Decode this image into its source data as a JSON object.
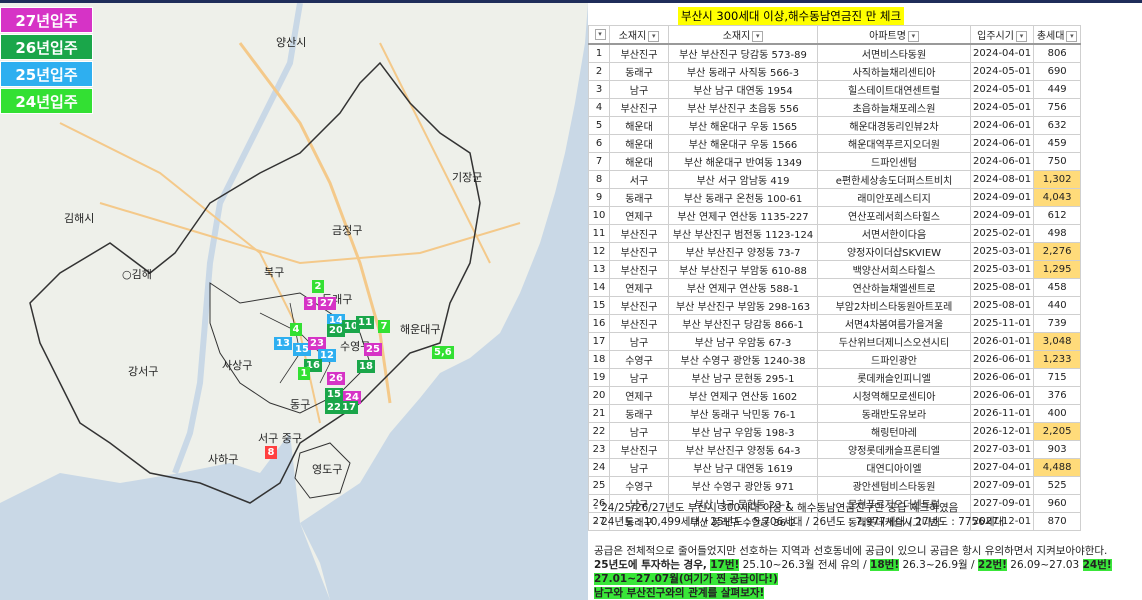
{
  "legend": [
    {
      "label": "27년입주",
      "color": "#d633c6"
    },
    {
      "label": "26년입주",
      "color": "#1aa64a"
    },
    {
      "label": "25년입주",
      "color": "#2eaff0"
    },
    {
      "label": "24년입주",
      "color": "#33e033"
    }
  ],
  "map_places": {
    "yangsan": "양산시",
    "gijang": "기장군",
    "gimhae": "김해시",
    "geumjeong": "금정구",
    "bukgu": "북구",
    "gangseo": "강서구",
    "sasang": "사상구",
    "haeundae": "해운대구",
    "donggu": "동구",
    "saha": "사하구",
    "yeongdo": "영도구",
    "junggu": "서구 중구",
    "gimhae2": "○김해",
    "dongrae": "동래구",
    "suyeong": "수영구"
  },
  "markers": [
    {
      "t": "2",
      "c": "#33e033"
    },
    {
      "t": "3",
      "c": "#d633c6"
    },
    {
      "t": "27",
      "c": "#d633c6"
    },
    {
      "t": "14",
      "c": "#2eaff0"
    },
    {
      "t": "20",
      "c": "#1aa64a"
    },
    {
      "t": "10",
      "c": "#1aa64a"
    },
    {
      "t": "11",
      "c": "#1aa64a"
    },
    {
      "t": "7",
      "c": "#33e033"
    },
    {
      "t": "4",
      "c": "#33e033"
    },
    {
      "t": "13",
      "c": "#2eaff0"
    },
    {
      "t": "15",
      "c": "#2eaff0"
    },
    {
      "t": "23",
      "c": "#d633c6"
    },
    {
      "t": "12",
      "c": "#2eaff0"
    },
    {
      "t": "16",
      "c": "#1aa64a"
    },
    {
      "t": "25",
      "c": "#d633c6"
    },
    {
      "t": "1",
      "c": "#33e033"
    },
    {
      "t": "18",
      "c": "#1aa64a"
    },
    {
      "t": "5,6",
      "c": "#33e033"
    },
    {
      "t": "26",
      "c": "#d633c6"
    },
    {
      "t": "15",
      "c": "#1aa64a"
    },
    {
      "t": "24",
      "c": "#d633c6"
    },
    {
      "t": "22",
      "c": "#1aa64a"
    },
    {
      "t": "17",
      "c": "#1aa64a"
    },
    {
      "t": "8",
      "c": "#ff4040"
    }
  ],
  "table": {
    "title": "부산시 300세대 이상,해수동남연금진 만 체크",
    "headers": [
      "",
      "소재지",
      "소재지",
      "아파트명",
      "입주시기",
      "총세대"
    ],
    "rows": [
      [
        "1",
        "부산진구",
        "부산 부산진구 당감동 573-89",
        "서면비스타동원",
        "2024-04-01",
        "806",
        ""
      ],
      [
        "2",
        "동래구",
        "부산 동래구 사직동 566-3",
        "사직하늘채리센티아",
        "2024-05-01",
        "690",
        ""
      ],
      [
        "3",
        "남구",
        "부산 남구 대연동 1954",
        "힐스테이트대연센트럴",
        "2024-05-01",
        "449",
        ""
      ],
      [
        "4",
        "부산진구",
        "부산 부산진구 초읍동 556",
        "초읍하늘채포레스원",
        "2024-05-01",
        "756",
        ""
      ],
      [
        "5",
        "해운대",
        "부산 해운대구 우동 1565",
        "해운대경동리인뷰2차",
        "2024-06-01",
        "632",
        ""
      ],
      [
        "6",
        "해운대",
        "부산 해운대구 우동 1566",
        "해운대역푸르지오더원",
        "2024-06-01",
        "459",
        ""
      ],
      [
        "7",
        "해운대",
        "부산 해운대구 반여동 1349",
        "드파인센텀",
        "2024-06-01",
        "750",
        ""
      ],
      [
        "8",
        "서구",
        "부산 서구 암남동 419",
        "e편한세상송도더퍼스트비치",
        "2024-08-01",
        "1,302",
        "hl"
      ],
      [
        "9",
        "동래구",
        "부산 동래구 온천동 100-61",
        "래미안포레스티지",
        "2024-09-01",
        "4,043",
        "hl"
      ],
      [
        "10",
        "연제구",
        "부산 연제구 연산동 1135-227",
        "연산포레서희스타힐스",
        "2024-09-01",
        "612",
        ""
      ],
      [
        "11",
        "부산진구",
        "부산 부산진구 범전동 1123-124",
        "서면서한이다음",
        "2025-02-01",
        "498",
        ""
      ],
      [
        "12",
        "부산진구",
        "부산 부산진구 양정동 73-7",
        "양정자이더샵SKVIEW",
        "2025-03-01",
        "2,276",
        "hl"
      ],
      [
        "13",
        "부산진구",
        "부산 부산진구 부암동 610-88",
        "백양산서희스타힐스",
        "2025-03-01",
        "1,295",
        "hl"
      ],
      [
        "14",
        "연제구",
        "부산 연제구 연산동 588-1",
        "연산하늘채엘센트로",
        "2025-08-01",
        "458",
        ""
      ],
      [
        "15",
        "부산진구",
        "부산 부산진구 부암동 298-163",
        "부암2차비스타동원아트포레",
        "2025-08-01",
        "440",
        ""
      ],
      [
        "16",
        "부산진구",
        "부산 부산진구 당감동 866-1",
        "서면4차봄여름가을겨울",
        "2025-11-01",
        "739",
        ""
      ],
      [
        "17",
        "남구",
        "부산 남구 우암동 67-3",
        "두산위브더제니스오션시티",
        "2026-01-01",
        "3,048",
        "hl"
      ],
      [
        "18",
        "수영구",
        "부산 수영구 광안동 1240-38",
        "드파인광안",
        "2026-06-01",
        "1,233",
        "hl"
      ],
      [
        "19",
        "남구",
        "부산 남구 문현동 295-1",
        "롯데캐슬인피니엘",
        "2026-06-01",
        "715",
        ""
      ],
      [
        "20",
        "연제구",
        "부산 연제구 연산동 1602",
        "시청역해모로센티아",
        "2026-06-01",
        "376",
        ""
      ],
      [
        "21",
        "동래구",
        "부산 동래구 낙민동 76-1",
        "동래반도유보라",
        "2026-11-01",
        "400",
        ""
      ],
      [
        "22",
        "남구",
        "부산 남구 우암동 198-3",
        "해링턴마레",
        "2026-12-01",
        "2,205",
        "hl"
      ],
      [
        "23",
        "부산진구",
        "부산 부산진구 양정동 64-3",
        "양정롯데캐슬프론티엘",
        "2027-03-01",
        "903",
        ""
      ],
      [
        "24",
        "남구",
        "부산 남구 대연동 1619",
        "대연디아이엘",
        "2027-04-01",
        "4,488",
        "hl"
      ],
      [
        "25",
        "수영구",
        "부산 수영구 광안동 971",
        "광안센텀비스타동원",
        "2027-09-01",
        "525",
        ""
      ],
      [
        "26",
        "남구",
        "부산 남구 문현동 23-1",
        "문현푸르지오더센트럴",
        "2027-09-01",
        "960",
        ""
      ],
      [
        "27",
        "동래구",
        "부산 동래구 수안동 36-2",
        "동래롯데캐슬시그니처",
        "2027-12-01",
        "870",
        ""
      ]
    ]
  },
  "notes": {
    "line1": "- 24/25/26/27년도 부산시 300세대 이상 & 해수동남연금진구만 공급 체크하였음",
    "line2": "- 24년도 : 10,499세대 / 25년도 : 5,706세대 / 26년도 : 7,977세대 / 27년도 : 7756세대"
  },
  "paragraph": {
    "p1": "공급은 전체적으로 줄어들었지만 선호하는 지역과 선호동네에 공급이 있으니 공급은 항시 유의하면서 지켜보아야한다.",
    "p2a": "25년도에 투자하는 경우,",
    "p2b": "17번!",
    "p2c": " 25.10~26.3월 전세 유의 /",
    "p2d": "18번!",
    "p2e": " 26.3~26.9월 /",
    "p2f": "22번!",
    "p2g": " 26.09~27.03",
    "p2h": "24번!",
    "p3": "27.01~27.07월(여기가 찐 공급이다!)",
    "p4": "남구와 부산진구와의 관계를 살펴보자!"
  }
}
